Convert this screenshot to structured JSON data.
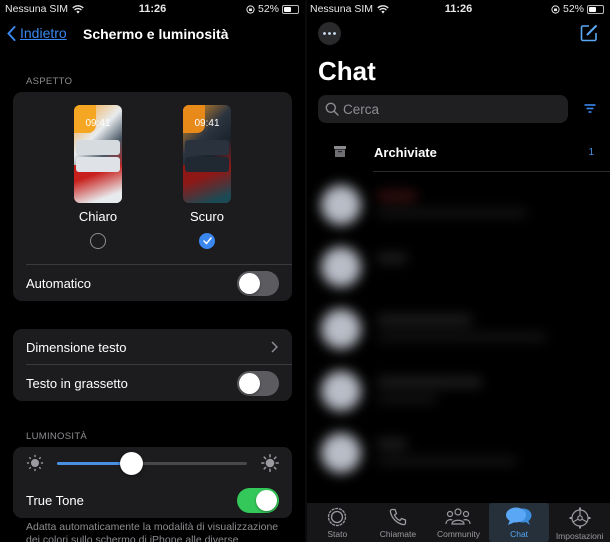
{
  "left_screen": {
    "status_bar": {
      "carrier": "Nessuna SIM",
      "time": "11:26",
      "battery": "52%",
      "battery_level": 0.52
    },
    "nav": {
      "back_label": "Indietro",
      "title": "Schermo e luminosità"
    },
    "appearance": {
      "section_label": "ASPETTO",
      "options": [
        {
          "label": "Chiaro",
          "preview_time": "09:41",
          "selected": false
        },
        {
          "label": "Scuro",
          "preview_time": "09:41",
          "selected": true
        }
      ],
      "automatic_label": "Automatico",
      "automatic_on": false
    },
    "text_settings": {
      "text_size_label": "Dimensione testo",
      "bold_text_label": "Testo in grassetto",
      "bold_text_on": false
    },
    "brightness": {
      "section_label": "LUMINOSITÀ",
      "level": 0.39,
      "true_tone_label": "True Tone",
      "true_tone_on": true,
      "footnote": "Adatta automaticamente la modalità di visualizzazione dei colori sullo schermo di iPhone alle diverse"
    }
  },
  "right_screen": {
    "status_bar": {
      "carrier": "Nessuna SIM",
      "time": "11:26",
      "battery": "52%",
      "battery_level": 0.52
    },
    "title": "Chat",
    "search_placeholder": "Cerca",
    "archived": {
      "label": "Archiviate",
      "count": "1"
    },
    "tabs": [
      {
        "label": "Stato",
        "icon": "status-icon",
        "active": false
      },
      {
        "label": "Chiamate",
        "icon": "phone-icon",
        "active": false
      },
      {
        "label": "Community",
        "icon": "community-icon",
        "active": false
      },
      {
        "label": "Chat",
        "icon": "chat-bubbles-icon",
        "active": true
      },
      {
        "label": "Impostazioni",
        "icon": "gear-icon",
        "active": false
      }
    ],
    "accent_color": "#3a87f0"
  }
}
